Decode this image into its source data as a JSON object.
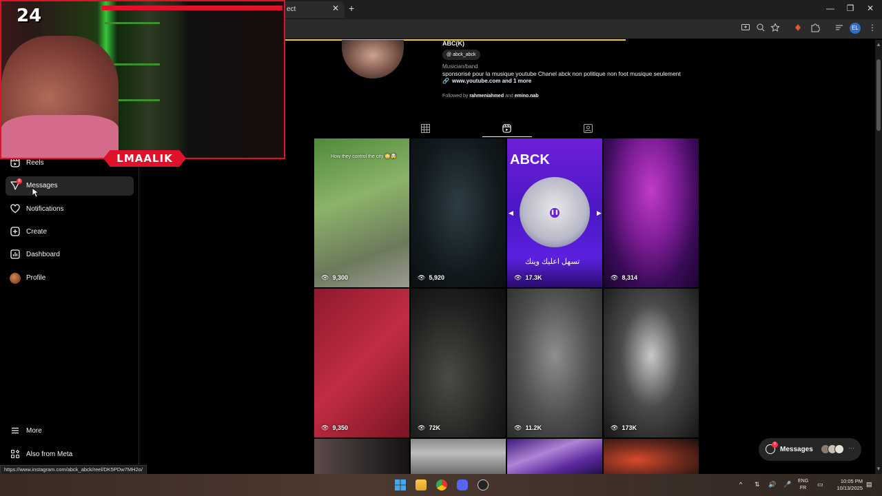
{
  "browser": {
    "tab_title": "ect",
    "tab_close": "✕",
    "new_tab": "+",
    "window_minimize": "—",
    "window_maximize": "❐",
    "window_close": "✕",
    "profile_initials": "EL",
    "status_url": "https://www.instagram.com/abck_abck/reel/DK5PDw7MH2o/"
  },
  "overlay": {
    "counter": "24",
    "streamer_label": "LMAALIK",
    "accent_color": "#e0112b"
  },
  "sidebar": {
    "items": [
      {
        "label": "Reels",
        "icon": "reels-icon"
      },
      {
        "label": "Messages",
        "icon": "messages-icon",
        "badge": "8"
      },
      {
        "label": "Notifications",
        "icon": "heart-icon"
      },
      {
        "label": "Create",
        "icon": "plus-square-icon"
      },
      {
        "label": "Dashboard",
        "icon": "chart-icon"
      },
      {
        "label": "Profile",
        "icon": "avatar-icon"
      }
    ],
    "more_label": "More",
    "meta_label": "Also from Meta"
  },
  "profile": {
    "username": "ABC(K)",
    "threads_handle": "abck_abck",
    "category": "Musician/band",
    "bio": "sponsorisé pour la musique youtube Chanel abck non politique non foot musique seulement",
    "link": "www.youtube.com and 1 more",
    "followed_prefix": "Followed by",
    "followed_user1": "rahmeniahmed",
    "followed_and": "and",
    "followed_user2": "emino.nab"
  },
  "tabs": [
    {
      "name": "posts",
      "icon": "grid-icon"
    },
    {
      "name": "reels",
      "icon": "reels-icon",
      "active": true
    },
    {
      "name": "tagged",
      "icon": "tagged-icon"
    }
  ],
  "reels": [
    {
      "views": "9,300",
      "caption": "How they control the city 😳🤯"
    },
    {
      "views": "5,920"
    },
    {
      "views": "17.3K",
      "overlay_text": "ABCK",
      "arabic": "تسهل اعليك وينك"
    },
    {
      "views": "8,314"
    },
    {
      "views": "9,350"
    },
    {
      "views": "72K"
    },
    {
      "views": "11.2K"
    },
    {
      "views": "173K"
    },
    {
      "views": ""
    },
    {
      "views": ""
    },
    {
      "views": ""
    },
    {
      "views": ""
    }
  ],
  "floating_messages": {
    "label": "Messages",
    "badge": "8",
    "more": "···"
  },
  "taskbar": {
    "lang_line1": "ENG",
    "lang_line2": "FR",
    "time": "10:05 PM",
    "date": "10/13/2025"
  }
}
